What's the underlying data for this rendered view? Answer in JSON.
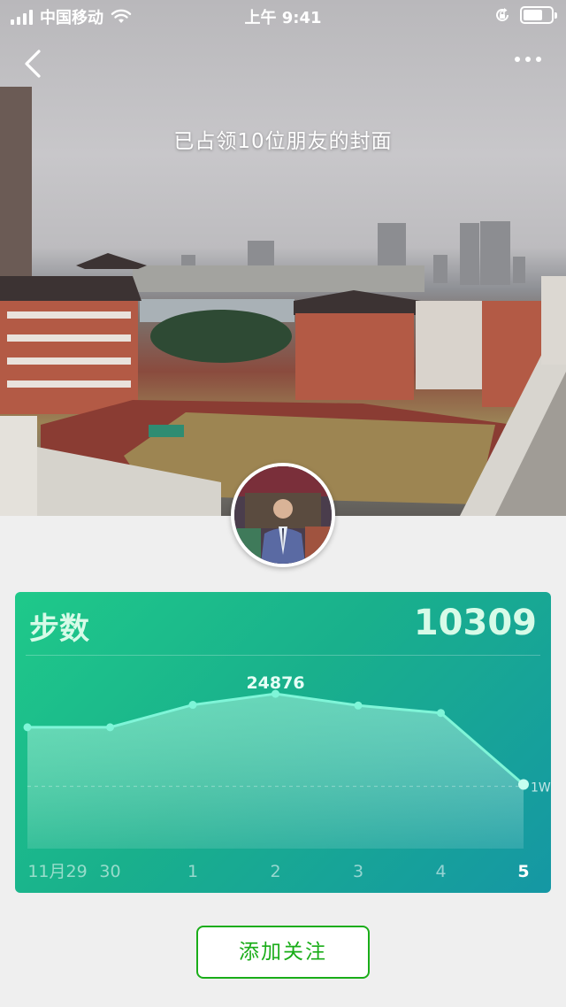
{
  "status_bar": {
    "carrier": "中国移动",
    "time": "上午 9:41",
    "battery_level": 0.7,
    "icons": [
      "signal-icon",
      "wifi-icon",
      "rotation-lock-icon",
      "battery-icon"
    ]
  },
  "nav": {
    "back_icon": "chevron-left-icon",
    "more_icon": "more-dots-icon"
  },
  "cover": {
    "caption": "已占领10位朋友的封面"
  },
  "card": {
    "title": "步数",
    "total": "10309"
  },
  "chart_data": {
    "type": "area",
    "categories": [
      "11月29",
      "30",
      "1",
      "2",
      "3",
      "4",
      "5"
    ],
    "values": [
      19500,
      19500,
      23100,
      24876,
      23000,
      21800,
      10309
    ],
    "peak_label": "24876",
    "reference_line": {
      "value": 10000,
      "label": "1W"
    },
    "ylim": [
      0,
      31000
    ],
    "highlighted_category": "5",
    "colors": {
      "line": "#7ff5d8",
      "fill_top": "#9ff3dc",
      "fill_bottom": "#2aa8a5"
    }
  },
  "actions": {
    "follow_label": "添加关注"
  },
  "colors": {
    "card_gradient_start": "#1fc98a",
    "card_gradient_end": "#1597a4",
    "accent_green": "#1aad19"
  }
}
